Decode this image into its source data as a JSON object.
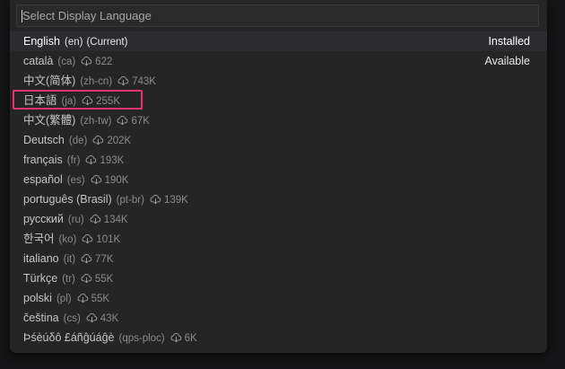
{
  "search": {
    "placeholder": "Select Display Language",
    "value": ""
  },
  "languages": [
    {
      "name": "English",
      "code": "(en)",
      "suffix": "(Current)",
      "count": "",
      "status": "Installed",
      "current": true
    },
    {
      "name": "català",
      "code": "(ca)",
      "suffix": "",
      "count": "622",
      "status": "Available"
    },
    {
      "name": "中文(简体)",
      "code": "(zh-cn)",
      "suffix": "",
      "count": "743K",
      "status": ""
    },
    {
      "name": "日本語",
      "code": "(ja)",
      "suffix": "",
      "count": "255K",
      "status": "",
      "highlighted": true
    },
    {
      "name": "中文(繁體)",
      "code": "(zh-tw)",
      "suffix": "",
      "count": "67K",
      "status": ""
    },
    {
      "name": "Deutsch",
      "code": "(de)",
      "suffix": "",
      "count": "202K",
      "status": ""
    },
    {
      "name": "français",
      "code": "(fr)",
      "suffix": "",
      "count": "193K",
      "status": ""
    },
    {
      "name": "español",
      "code": "(es)",
      "suffix": "",
      "count": "190K",
      "status": ""
    },
    {
      "name": "português (Brasil)",
      "code": "(pt-br)",
      "suffix": "",
      "count": "139K",
      "status": ""
    },
    {
      "name": "русский",
      "code": "(ru)",
      "suffix": "",
      "count": "134K",
      "status": ""
    },
    {
      "name": "한국어",
      "code": "(ko)",
      "suffix": "",
      "count": "101K",
      "status": ""
    },
    {
      "name": "italiano",
      "code": "(it)",
      "suffix": "",
      "count": "77K",
      "status": ""
    },
    {
      "name": "Türkçe",
      "code": "(tr)",
      "suffix": "",
      "count": "55K",
      "status": ""
    },
    {
      "name": "polski",
      "code": "(pl)",
      "suffix": "",
      "count": "55K",
      "status": ""
    },
    {
      "name": "čeština",
      "code": "(cs)",
      "suffix": "",
      "count": "43K",
      "status": ""
    },
    {
      "name": "Þśèúδô £áñĝúáĝè",
      "code": "(qps-ploc)",
      "suffix": "",
      "count": "6K",
      "status": ""
    }
  ],
  "icons": {
    "download": "cloud-download-icon"
  },
  "colors": {
    "highlight_border": "#e8336f",
    "current_row_bg": "#2c2c30",
    "palette_bg": "#252526"
  }
}
